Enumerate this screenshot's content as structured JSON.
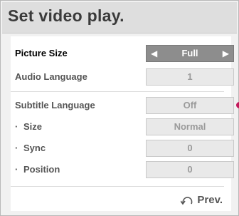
{
  "dialog": {
    "title": "Set video play."
  },
  "options": [
    {
      "label": "Picture Size",
      "value": "Full",
      "bullet": "",
      "active": true
    },
    {
      "label": "Audio Language",
      "value": "1",
      "bullet": "",
      "active": false
    },
    {
      "label": "Subtitle Language",
      "value": "Off",
      "bullet": "",
      "active": false
    },
    {
      "label": "Size",
      "value": "Normal",
      "bullet": "·",
      "active": false
    },
    {
      "label": "Sync",
      "value": "0",
      "bullet": "·",
      "active": false
    },
    {
      "label": "Position",
      "value": "0",
      "bullet": "·",
      "active": false
    }
  ],
  "arrows": {
    "left": "◀",
    "right": "▶"
  },
  "footer": {
    "icon": "back-return-icon",
    "prev_label": "Prev."
  },
  "colors": {
    "active_value_bg": "#8d8d8d",
    "accent_dot": "#c2185b"
  }
}
